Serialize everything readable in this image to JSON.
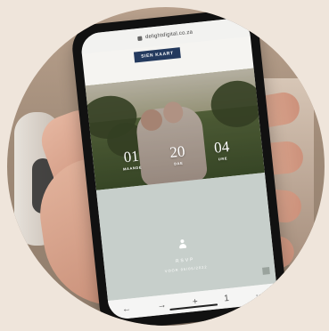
{
  "browser": {
    "url": "delightdigital.co.za"
  },
  "page": {
    "view_map_button": "SIEN KAART",
    "countdown": [
      {
        "value": "01",
        "label": "MAANDE"
      },
      {
        "value": "20",
        "label": "DAE"
      },
      {
        "value": "04",
        "label": "URE"
      }
    ],
    "rsvp_title": "RSVP",
    "rsvp_subtitle": "VOOR 05/05/2022"
  },
  "toolbar": {
    "icons": [
      "back-arrow-icon",
      "forward-arrow-icon",
      "new-tab-icon",
      "tabs-icon",
      "more-icon"
    ],
    "back_label": "←",
    "forward_label": "→",
    "plus_label": "+",
    "tabs_label": "1",
    "more_label": "···"
  }
}
